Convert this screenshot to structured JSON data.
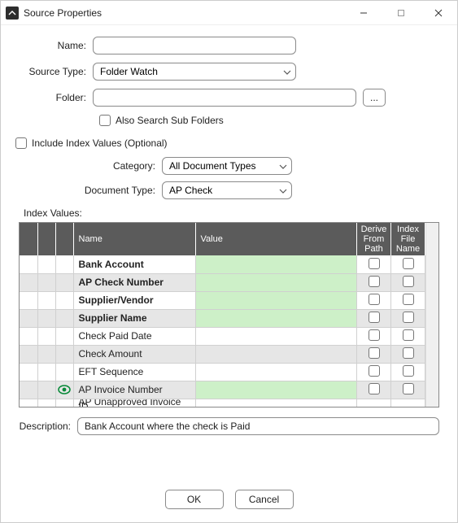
{
  "window": {
    "title": "Source Properties"
  },
  "form": {
    "name_label": "Name:",
    "name_value": "",
    "source_type_label": "Source Type:",
    "source_type_value": "Folder Watch",
    "folder_label": "Folder:",
    "folder_value": "",
    "browse_label": "...",
    "subfolders_label": "Also Search Sub Folders",
    "include_index_label": "Include Index Values (Optional)",
    "category_label": "Category:",
    "category_value": "All Document Types",
    "doctype_label": "Document Type:",
    "doctype_value": "AP Check"
  },
  "grid": {
    "section_label": "Index Values:",
    "headers": {
      "name": "Name",
      "value": "Value",
      "derive": "Derive From Path",
      "index": "Index File Name"
    },
    "rows": [
      {
        "name": "Bank Account",
        "bold": true,
        "green": true,
        "alt": false,
        "eye": false
      },
      {
        "name": "AP Check Number",
        "bold": true,
        "green": true,
        "alt": true,
        "eye": false
      },
      {
        "name": "Supplier/Vendor",
        "bold": true,
        "green": true,
        "alt": false,
        "eye": false
      },
      {
        "name": "Supplier Name",
        "bold": true,
        "green": true,
        "alt": true,
        "eye": false
      },
      {
        "name": "Check Paid Date",
        "bold": false,
        "green": false,
        "alt": false,
        "eye": false
      },
      {
        "name": "Check Amount",
        "bold": false,
        "green": false,
        "alt": true,
        "eye": false
      },
      {
        "name": "EFT Sequence",
        "bold": false,
        "green": false,
        "alt": false,
        "eye": false
      },
      {
        "name": "AP Invoice Number",
        "bold": false,
        "green": true,
        "alt": true,
        "eye": true
      }
    ],
    "partial_row_name": "AP Unapproved Invoice ID"
  },
  "description": {
    "label": "Description:",
    "value": "Bank Account where the check is Paid"
  },
  "buttons": {
    "ok": "OK",
    "cancel": "Cancel"
  }
}
